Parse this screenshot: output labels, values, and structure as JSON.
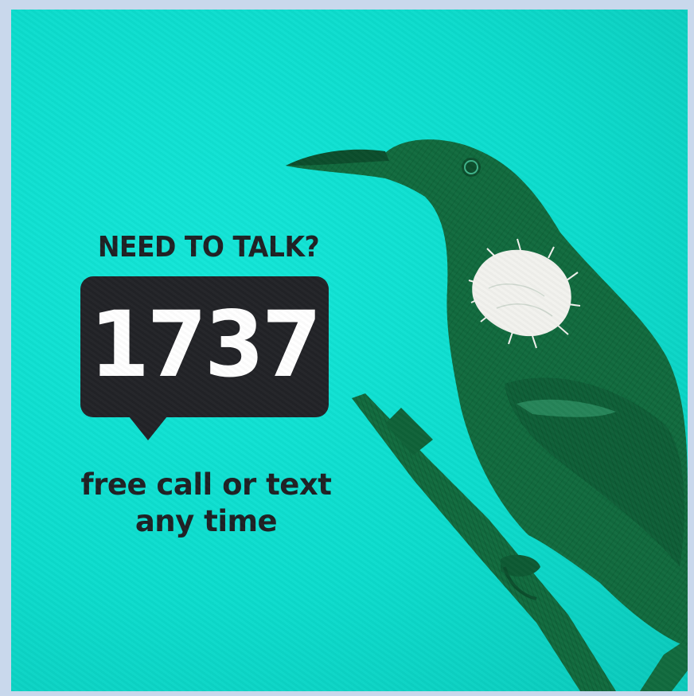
{
  "headline": "NEED TO TALK?",
  "number": "1737",
  "tagline": {
    "line1": "free call or text",
    "line2": "any time"
  },
  "colors": {
    "background": "#0cdccd",
    "bubble": "#222327",
    "text_dark": "#1f2124",
    "bird": "#116b3e",
    "bird_throat": "#f2f2ee"
  },
  "illustration": "tui-bird-on-branch"
}
